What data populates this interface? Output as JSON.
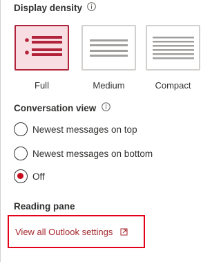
{
  "display_density": {
    "heading": "Display density",
    "info_icon": "info-icon",
    "options": [
      {
        "label": "Full",
        "selected": true
      },
      {
        "label": "Medium",
        "selected": false
      },
      {
        "label": "Compact",
        "selected": false
      }
    ]
  },
  "conversation_view": {
    "heading": "Conversation view",
    "info_icon": "info-icon",
    "options": [
      {
        "label": "Newest messages on top",
        "selected": false
      },
      {
        "label": "Newest messages on bottom",
        "selected": false
      },
      {
        "label": "Off",
        "selected": true
      }
    ]
  },
  "reading_pane": {
    "heading": "Reading pane"
  },
  "settings_link": {
    "label": "View all Outlook settings",
    "icon": "open-in-new-window-icon"
  },
  "colors": {
    "accent": "#b1233b",
    "selected_fill": "#f8dde2",
    "radio_dot": "#c50f1f",
    "highlight_border": "#e3001b",
    "link_text": "#a4262c"
  }
}
